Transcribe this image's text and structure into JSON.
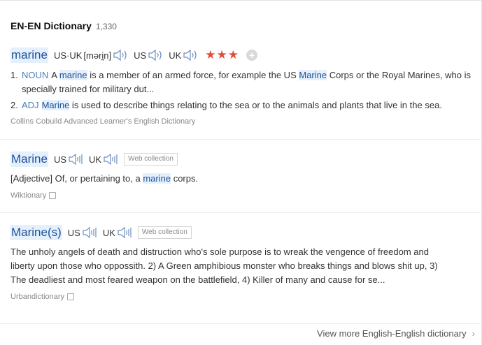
{
  "header": {
    "title": "EN-EN Dictionary",
    "count": "1,330"
  },
  "collins": {
    "headword": "marine",
    "pron_both_label": "US·UK",
    "ipa": "[mərḭn]",
    "us_label": "US",
    "uk_label": "UK",
    "stars": [
      "★",
      "★",
      "★"
    ],
    "plus": "+",
    "senses": [
      {
        "num": "1.",
        "pos": "NOUN",
        "t1": "A ",
        "h1": "marine",
        "t2": " is a member of an armed force, for example the US ",
        "h2": "Marine",
        "t3": " Corps or the Royal Marines, who is specially trained for military dut..."
      },
      {
        "num": "2.",
        "pos": "ADJ",
        "h1": "Marine",
        "t2": " is used to describe things relating to the sea or to the animals and plants that live in the sea."
      }
    ],
    "source": "Collins Cobuild Advanced Learner's English Dictionary"
  },
  "wiktionary": {
    "headword": "Marine",
    "us_label": "US",
    "uk_label": "UK",
    "tag": "Web collection",
    "t1": "[Adjective] Of, or pertaining to, a ",
    "h1": "marine",
    "t2": " corps.",
    "source": "Wiktionary"
  },
  "urban": {
    "headword": "Marine(s)",
    "us_label": "US",
    "uk_label": "UK",
    "tag": "Web collection",
    "line1": "The unholy angels of death and distruction who's sole purpose is to wreak the vengence of freedom and",
    "line2": "liberty upon those who oppossith. 2) A Green amphibious monster who breaks things and blows shit up, 3)",
    "line3": "The deadliest and most feared weapon on the battlefield, 4) Killer of many and cause for se...",
    "source": "Urbandictionary"
  },
  "footer": {
    "label": "View more English-English dictionary",
    "chevron": "›"
  }
}
